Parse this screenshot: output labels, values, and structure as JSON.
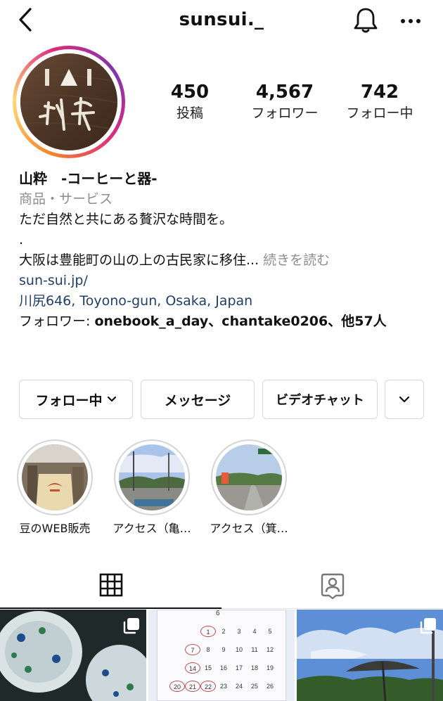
{
  "header": {
    "username": "sunsui._",
    "back_icon": "chevron-left-icon",
    "bell_icon": "bell-icon",
    "more_icon": "more-horizontal-icon"
  },
  "stats": [
    {
      "value": "450",
      "label": "投稿"
    },
    {
      "value": "4,567",
      "label": "フォロワー"
    },
    {
      "value": "742",
      "label": "フォロー中"
    }
  ],
  "bio": {
    "name": "山粋　-コーヒーと器-",
    "category": "商品・サービス",
    "line1": "ただ自然と共にある贅沢な時間を。",
    "line2": ".",
    "line3": "大阪は豊能町の山の上の古民家に移住...",
    "more_label": " 続きを読む",
    "website": "sun-sui.jp/",
    "address": "川尻646, Toyono-gun, Osaka, Japan",
    "followed_by_prefix": "フォロワー: ",
    "followed_by_names": "onebook_a_day、chantake0206、他57人"
  },
  "actions": {
    "following": "フォロー中",
    "message": "メッセージ",
    "video_chat": "ビデオチャット"
  },
  "highlights": [
    {
      "label": "豆のWEB販売"
    },
    {
      "label": "アクセス（亀…"
    },
    {
      "label": "アクセス（箕…"
    }
  ],
  "tabs": {
    "posts_icon": "grid-icon",
    "tagged_icon": "tagged-person-icon"
  },
  "calendar_post": {
    "header": "6",
    "rows": [
      [
        "1",
        "2",
        "3",
        "4",
        "5"
      ],
      [
        "7",
        "8",
        "9",
        "10",
        "11",
        "12"
      ],
      [
        "14",
        "15",
        "16",
        "17",
        "18",
        "19"
      ],
      [
        "20",
        "21",
        "22",
        "23",
        "24",
        "25",
        "26"
      ]
    ]
  },
  "colors": {
    "link": "#1f3f6b",
    "muted": "#8e8e8e",
    "border": "#d8d8d8"
  }
}
